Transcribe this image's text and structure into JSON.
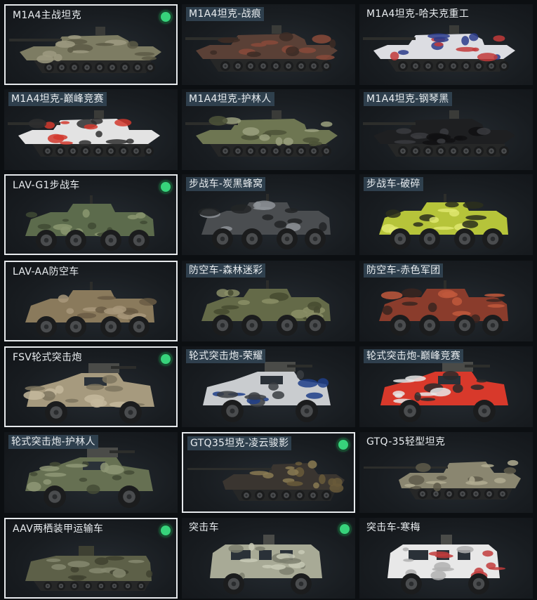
{
  "skins": [
    {
      "label": "M1A4主战坦克",
      "selected": true,
      "owned": true,
      "tagged": false,
      "type": "tank",
      "colors": [
        "#7d7c63",
        "#5c5a45",
        "#9c9a80"
      ]
    },
    {
      "label": "M1A4坦克-战痕",
      "selected": false,
      "owned": false,
      "tagged": true,
      "type": "tank",
      "colors": [
        "#5a4036",
        "#3c2b24",
        "#8a4a3a"
      ]
    },
    {
      "label": "M1A4坦克-哈夫克重工",
      "selected": false,
      "owned": false,
      "tagged": false,
      "type": "tank",
      "colors": [
        "#dcdde2",
        "#2a3b8a",
        "#c23a3a"
      ]
    },
    {
      "label": "M1A4坦克-巅峰竞赛",
      "selected": false,
      "owned": false,
      "tagged": true,
      "type": "tank",
      "colors": [
        "#e3e3e3",
        "#d23a2e",
        "#2f2f2f"
      ]
    },
    {
      "label": "M1A4坦克-护林人",
      "selected": false,
      "owned": false,
      "tagged": true,
      "type": "tank",
      "colors": [
        "#6e7652",
        "#4d5438",
        "#9aa07e"
      ]
    },
    {
      "label": "M1A4坦克-钢琴黑",
      "selected": false,
      "owned": false,
      "tagged": true,
      "type": "tank",
      "colors": [
        "#1e1f21",
        "#101112",
        "#3a3b3e"
      ]
    },
    {
      "label": "LAV-G1步战车",
      "selected": true,
      "owned": true,
      "tagged": false,
      "type": "apc",
      "colors": [
        "#5c6b4c",
        "#3f4a34",
        "#8a9670"
      ]
    },
    {
      "label": "步战车-炭黑蜂窝",
      "selected": false,
      "owned": false,
      "tagged": true,
      "type": "apc",
      "colors": [
        "#4a4d50",
        "#222426",
        "#8d9296"
      ]
    },
    {
      "label": "步战车-破碎",
      "selected": false,
      "owned": false,
      "tagged": true,
      "type": "apc",
      "colors": [
        "#b6c43a",
        "#2b2f1c",
        "#dfe870"
      ]
    },
    {
      "label": "LAV-AA防空车",
      "selected": true,
      "owned": false,
      "tagged": false,
      "type": "apc",
      "colors": [
        "#8a7a5c",
        "#6a5c44",
        "#a8987a"
      ]
    },
    {
      "label": "防空车-森林迷彩",
      "selected": false,
      "owned": false,
      "tagged": true,
      "type": "apc",
      "colors": [
        "#646a48",
        "#454a30",
        "#8a8e66"
      ]
    },
    {
      "label": "防空车-赤色军团",
      "selected": false,
      "owned": false,
      "tagged": true,
      "type": "apc",
      "colors": [
        "#8a3c2c",
        "#3a2420",
        "#c0583c"
      ]
    },
    {
      "label": "FSV轮式突击炮",
      "selected": true,
      "owned": true,
      "tagged": false,
      "type": "mrap",
      "colors": [
        "#a69a7e",
        "#7d745e",
        "#c4b99c"
      ]
    },
    {
      "label": "轮式突击炮-荣耀",
      "selected": false,
      "owned": false,
      "tagged": true,
      "type": "mrap",
      "colors": [
        "#c9cccf",
        "#1f3e8a",
        "#3a3d42"
      ]
    },
    {
      "label": "轮式突击炮-巅峰竞赛",
      "selected": false,
      "owned": false,
      "tagged": true,
      "type": "mrap",
      "colors": [
        "#d8392b",
        "#e8e8e8",
        "#2a2a2a"
      ]
    },
    {
      "label": "轮式突击炮-护林人",
      "selected": false,
      "owned": false,
      "tagged": true,
      "type": "mrap",
      "colors": [
        "#667052",
        "#444b36",
        "#8e9676"
      ]
    },
    {
      "label": "GTQ35坦克-凌云骏影",
      "selected": true,
      "owned": true,
      "tagged": true,
      "type": "light",
      "colors": [
        "#3a3530",
        "#8a7a52",
        "#6a5a3a"
      ]
    },
    {
      "label": "GTQ-35轻型坦克",
      "selected": false,
      "owned": false,
      "tagged": false,
      "type": "light",
      "colors": [
        "#8a8670",
        "#5e5b4a",
        "#b0ab90"
      ]
    },
    {
      "label": "AAV两栖装甲运输车",
      "selected": true,
      "owned": true,
      "tagged": false,
      "type": "aav",
      "colors": [
        "#5d6048",
        "#3f4230",
        "#858870"
      ]
    },
    {
      "label": "突击车",
      "selected": false,
      "owned": true,
      "tagged": false,
      "type": "truck",
      "colors": [
        "#a8aa96",
        "#7d7f6e",
        "#c8cab6"
      ]
    },
    {
      "label": "突击车-寒梅",
      "selected": false,
      "owned": false,
      "tagged": false,
      "type": "truck",
      "colors": [
        "#e8e8e8",
        "#c23c3c",
        "#b0b0b0"
      ]
    }
  ],
  "colors": {
    "owned_dot": "#37d37b",
    "label_tag": "#344656",
    "selected_border": "#e6e9ec"
  }
}
